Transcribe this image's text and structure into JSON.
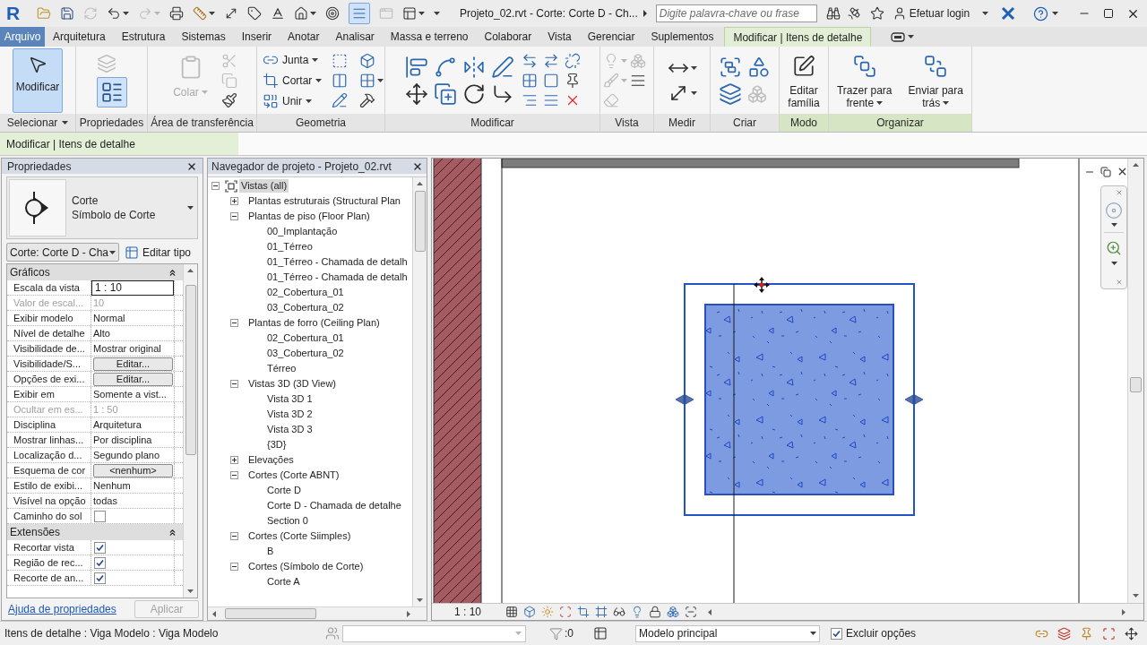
{
  "title_bar": {
    "logo": "R",
    "quick_access": [
      {
        "selected": false,
        "disabled": false
      },
      {
        "selected": false,
        "disabled": false
      },
      {
        "selected": false,
        "disabled": true
      },
      {
        "selected": false,
        "disabled": false
      },
      {
        "selected": false,
        "disabled": true
      },
      {
        "selected": false,
        "disabled": false
      },
      {
        "selected": false,
        "disabled": false
      },
      {
        "selected": false,
        "disabled": false
      },
      {
        "selected": false,
        "disabled": false
      },
      {
        "selected": false,
        "disabled": false
      },
      {
        "selected": false,
        "disabled": false
      },
      {
        "selected": false,
        "disabled": false
      },
      {
        "selected": true,
        "disabled": false
      },
      {
        "selected": false,
        "disabled": true
      },
      {
        "selected": false,
        "disabled": false
      }
    ],
    "title": "Projeto_02.rvt - Corte: Corte D - Ch...",
    "search": {
      "placeholder": "Digite palavra-chave ou frase"
    },
    "login": "Efetuar login"
  },
  "tabs": [
    {
      "label": "Arquivo",
      "kind": "file",
      "selected": false
    },
    {
      "label": "Arquitetura",
      "kind": "tab",
      "selected": false
    },
    {
      "label": "Estrutura",
      "kind": "tab",
      "selected": false
    },
    {
      "label": "Sistemas",
      "kind": "tab",
      "selected": false
    },
    {
      "label": "Inserir",
      "kind": "tab",
      "selected": false
    },
    {
      "label": "Anotar",
      "kind": "tab",
      "selected": false
    },
    {
      "label": "Analisar",
      "kind": "tab",
      "selected": false
    },
    {
      "label": "Massa e terreno",
      "kind": "tab",
      "selected": false
    },
    {
      "label": "Colaborar",
      "kind": "tab",
      "selected": false
    },
    {
      "label": "Vista",
      "kind": "tab",
      "selected": false
    },
    {
      "label": "Gerenciar",
      "kind": "tab",
      "selected": false
    },
    {
      "label": "Suplementos",
      "kind": "tab",
      "selected": false
    },
    {
      "label": "Modificar | Itens de detalhe",
      "kind": "tab",
      "selected": true
    }
  ],
  "ribbon": {
    "panels": [
      {
        "title": "Selecionar",
        "menu": true,
        "contextual": false,
        "tools": [
          {
            "kind": "large",
            "label": "Modificar",
            "selected": true,
            "disabled": false
          }
        ]
      },
      {
        "title": "Propriedades",
        "menu": false,
        "contextual": false,
        "tools": [
          {
            "kind": "icon",
            "selected": false,
            "disabled": true
          },
          {
            "kind": "icon",
            "selected": true,
            "disabled": false
          }
        ]
      },
      {
        "title": "Área de transferência",
        "menu": false,
        "contextual": false,
        "tools": [
          {
            "kind": "large",
            "label": "Colar",
            "selected": false,
            "disabled": true
          },
          {
            "kind": "icon",
            "selected": false,
            "disabled": true
          },
          {
            "kind": "icon",
            "selected": false,
            "disabled": true
          },
          {
            "kind": "icon",
            "selected": false,
            "disabled": false
          }
        ]
      },
      {
        "title": "Geometria",
        "menu": false,
        "contextual": false,
        "tools": [
          {
            "kind": "small",
            "label": "Junta",
            "selected": false,
            "disabled": false
          },
          {
            "kind": "small",
            "label": "Cortar",
            "selected": false,
            "disabled": false
          },
          {
            "kind": "small",
            "label": "Unir",
            "selected": false,
            "disabled": false
          },
          {
            "kind": "icon",
            "selected": false,
            "disabled": false
          },
          {
            "kind": "icon",
            "selected": false,
            "disabled": false
          },
          {
            "kind": "icon",
            "selected": false,
            "disabled": false
          },
          {
            "kind": "icon",
            "selected": false,
            "disabled": false
          },
          {
            "kind": "icon",
            "selected": false,
            "disabled": false
          },
          {
            "kind": "icon",
            "selected": false,
            "disabled": false
          }
        ]
      },
      {
        "title": "Modificar",
        "menu": false,
        "contextual": false,
        "tools": [
          {
            "kind": "icon",
            "selected": false,
            "disabled": false
          },
          {
            "kind": "icon",
            "selected": false,
            "disabled": false
          },
          {
            "kind": "icon",
            "selected": false,
            "disabled": false
          },
          {
            "kind": "icon",
            "selected": false,
            "disabled": false
          },
          {
            "kind": "icon",
            "selected": false,
            "disabled": false
          },
          {
            "kind": "icon",
            "selected": false,
            "disabled": false
          },
          {
            "kind": "icon",
            "selected": false,
            "disabled": false
          },
          {
            "kind": "icon",
            "selected": false,
            "disabled": false
          },
          {
            "kind": "icon",
            "selected": false,
            "disabled": false
          },
          {
            "kind": "icon",
            "selected": false,
            "disabled": false
          },
          {
            "kind": "icon",
            "selected": false,
            "disabled": false
          },
          {
            "kind": "icon",
            "selected": false,
            "disabled": false
          },
          {
            "kind": "icon",
            "selected": false,
            "disabled": false
          },
          {
            "kind": "icon",
            "selected": false,
            "disabled": false
          },
          {
            "kind": "icon",
            "selected": false,
            "disabled": false
          },
          {
            "kind": "icon",
            "selected": false,
            "disabled": false
          },
          {
            "kind": "icon",
            "selected": false,
            "disabled": false
          }
        ]
      },
      {
        "title": "Vista",
        "menu": false,
        "contextual": false,
        "tools": [
          {
            "kind": "icon",
            "selected": false,
            "disabled": true
          },
          {
            "kind": "icon",
            "selected": false,
            "disabled": true
          },
          {
            "kind": "icon",
            "selected": false,
            "disabled": true
          },
          {
            "kind": "icon",
            "selected": false,
            "disabled": false
          },
          {
            "kind": "icon",
            "selected": false,
            "disabled": true
          }
        ]
      },
      {
        "title": "Medir",
        "menu": false,
        "contextual": false,
        "tools": [
          {
            "kind": "icon",
            "selected": false,
            "disabled": false
          },
          {
            "kind": "icon",
            "selected": false,
            "disabled": false
          }
        ]
      },
      {
        "title": "Criar",
        "menu": false,
        "contextual": false,
        "tools": [
          {
            "kind": "icon",
            "selected": false,
            "disabled": false
          },
          {
            "kind": "icon",
            "selected": false,
            "disabled": false
          },
          {
            "kind": "icon",
            "selected": false,
            "disabled": false
          },
          {
            "kind": "icon",
            "selected": false,
            "disabled": true
          }
        ]
      },
      {
        "title": "Modo",
        "menu": false,
        "contextual": true,
        "tools": [
          {
            "kind": "large",
            "label": "Editar família",
            "selected": false,
            "disabled": false
          }
        ]
      },
      {
        "title": "Organizar",
        "menu": false,
        "contextual": true,
        "tools": [
          {
            "kind": "large",
            "label": "Trazer para frente",
            "selected": false,
            "disabled": false
          },
          {
            "kind": "large",
            "label": "Enviar para trás",
            "selected": false,
            "disabled": false
          }
        ]
      }
    ]
  },
  "options_bar": {
    "label": "Modificar | Itens de detalhe"
  },
  "properties": {
    "title": "Propriedades",
    "type": {
      "family": "Corte",
      "name": "Símbolo de Corte"
    },
    "instance": "Corte: Corte D - Cha",
    "edit_type": "Editar tipo",
    "groups": [
      {
        "name": "Gráficos",
        "expanded": true,
        "rows": [
          {
            "name": "Escala da vista",
            "kind": "input",
            "value": "1 : 10",
            "disabled": false
          },
          {
            "name": "Valor de escal...",
            "kind": "text",
            "value": "10",
            "disabled": true
          },
          {
            "name": "Exibir modelo",
            "kind": "text",
            "value": "Normal",
            "disabled": false
          },
          {
            "name": "Nível de detalhe",
            "kind": "text",
            "value": "Alto",
            "disabled": false
          },
          {
            "name": "Visibilidade de...",
            "kind": "text",
            "value": "Mostrar original",
            "disabled": false
          },
          {
            "name": "Visibilidade/S...",
            "kind": "button",
            "value": "Editar...",
            "disabled": false
          },
          {
            "name": "Opções de exi...",
            "kind": "button",
            "value": "Editar...",
            "disabled": false
          },
          {
            "name": "Exibir em",
            "kind": "text",
            "value": "Somente a vist...",
            "disabled": false
          },
          {
            "name": "Ocultar em es...",
            "kind": "text",
            "value": "1 : 50",
            "disabled": true
          },
          {
            "name": "Disciplina",
            "kind": "text",
            "value": "Arquitetura",
            "disabled": false
          },
          {
            "name": "Mostrar linhas...",
            "kind": "text",
            "value": "Por disciplina",
            "disabled": false
          },
          {
            "name": "Localização d...",
            "kind": "text",
            "value": "Segundo plano",
            "disabled": false
          },
          {
            "name": "Esquema de cor",
            "kind": "button",
            "value": "<nenhum>",
            "disabled": false
          },
          {
            "name": "Estilo de exibi...",
            "kind": "text",
            "value": "Nenhum",
            "disabled": false
          },
          {
            "name": "Visível na opção",
            "kind": "text",
            "value": "todas",
            "disabled": false
          },
          {
            "name": "Caminho do sol",
            "kind": "checkbox",
            "checked": false,
            "disabled": false
          }
        ]
      },
      {
        "name": "Extensões",
        "expanded": true,
        "rows": [
          {
            "name": "Recortar vista",
            "kind": "checkbox",
            "checked": true,
            "disabled": false
          },
          {
            "name": "Região de rec...",
            "kind": "checkbox",
            "checked": true,
            "disabled": false
          },
          {
            "name": "Recorte de an...",
            "kind": "checkbox",
            "checked": true,
            "disabled": false
          }
        ]
      }
    ],
    "help_link": "Ajuda de propriedades",
    "apply": {
      "label": "Aplicar",
      "disabled": true
    }
  },
  "browser": {
    "title": "Navegador de projeto - Projeto_02.rvt",
    "tree": [
      {
        "label": "Vistas (all)",
        "expanded": true,
        "selected": true,
        "children": [
          {
            "label": "Plantas estruturais (Structural Plan",
            "expanded": false,
            "selected": false
          },
          {
            "label": "Plantas de piso (Floor Plan)",
            "expanded": true,
            "selected": false,
            "children": [
              {
                "label": "00_Implantação",
                "selected": false
              },
              {
                "label": "01_Térreo",
                "selected": false
              },
              {
                "label": "01_Térreo - Chamada de detalh",
                "selected": false
              },
              {
                "label": "01_Térreo - Chamada de detalh",
                "selected": false
              },
              {
                "label": "02_Cobertura_01",
                "selected": false
              },
              {
                "label": "03_Cobertura_02",
                "selected": false
              }
            ]
          },
          {
            "label": "Plantas de forro (Ceiling Plan)",
            "expanded": true,
            "selected": false,
            "children": [
              {
                "label": "02_Cobertura_01",
                "selected": false
              },
              {
                "label": "03_Cobertura_02",
                "selected": false
              },
              {
                "label": "Térreo",
                "selected": false
              }
            ]
          },
          {
            "label": "Vistas 3D (3D View)",
            "expanded": true,
            "selected": false,
            "children": [
              {
                "label": "Vista 3D 1",
                "selected": false
              },
              {
                "label": "Vista 3D 2",
                "selected": false
              },
              {
                "label": "Vista 3D 3",
                "selected": false
              },
              {
                "label": "{3D}",
                "selected": false
              }
            ]
          },
          {
            "label": "Elevações",
            "expanded": false,
            "selected": false
          },
          {
            "label": "Cortes (Corte ABNT)",
            "expanded": true,
            "selected": false,
            "children": [
              {
                "label": "Corte D",
                "selected": false
              },
              {
                "label": "Corte D - Chamada de detalhe",
                "selected": false
              },
              {
                "label": "Section 0",
                "selected": false
              }
            ]
          },
          {
            "label": "Cortes (Corte Siimples)",
            "expanded": true,
            "selected": false,
            "children": [
              {
                "label": "B",
                "selected": false
              }
            ]
          },
          {
            "label": "Cortes (Símbolo de Corte)",
            "expanded": true,
            "selected": false,
            "children": [
              {
                "label": "Corte A",
                "selected": false
              }
            ]
          }
        ]
      }
    ]
  },
  "view": {
    "scale": "1 : 10"
  },
  "status_bar": {
    "selection": "Itens de detalhe : Viga Modelo : Viga Modelo",
    "filter_count": ":0",
    "design_option": "Modelo principal",
    "exclude_options": {
      "label": "Excluir opções",
      "checked": true
    }
  }
}
